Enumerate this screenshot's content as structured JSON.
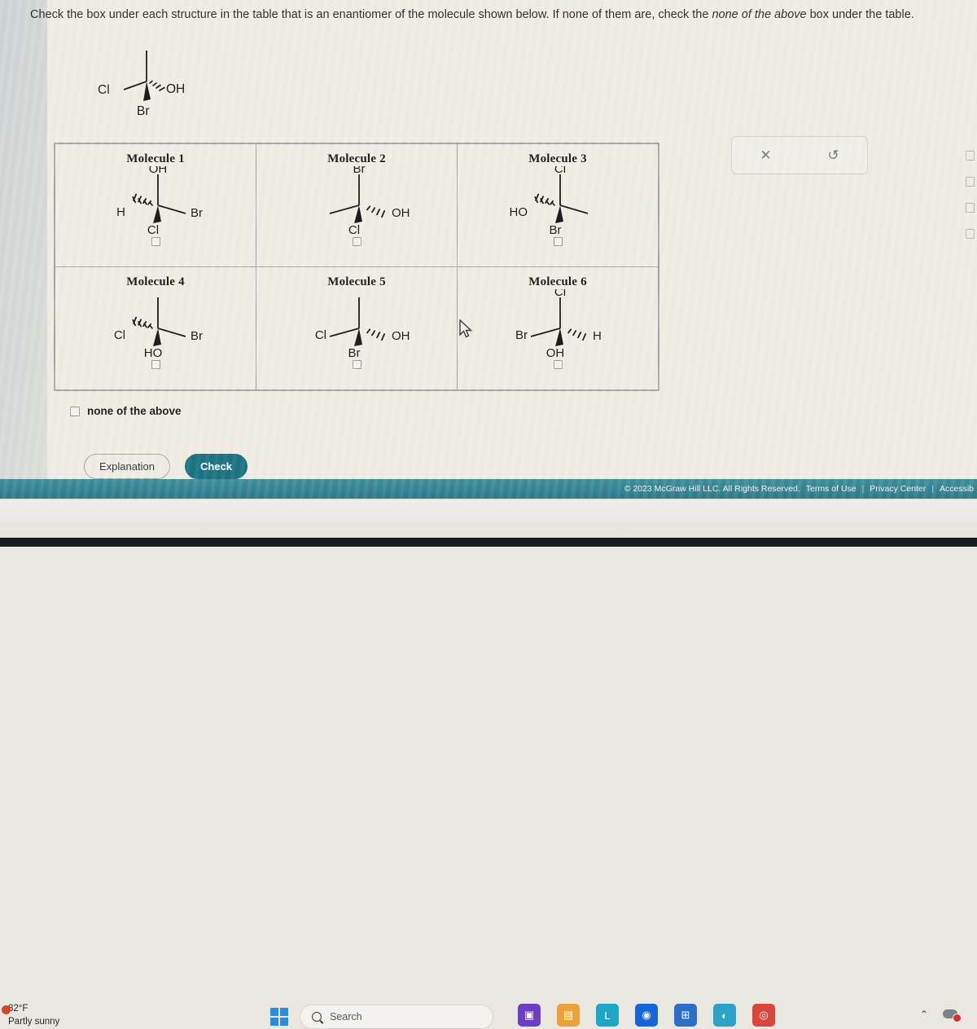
{
  "instruction": {
    "part1": "Check the box under each structure in the table that is an enantiomer of the molecule shown below. If none of them are, check the ",
    "italic": "none of the above",
    "part2": " box under the table."
  },
  "reference_molecule": {
    "name": "reference-stereocenter",
    "substituents": {
      "up": "",
      "left": "Cl",
      "right": "OH",
      "down": "Br"
    },
    "bond_styles": {
      "up": "plain",
      "left": "plain",
      "right": "hashed",
      "down": "wedge"
    }
  },
  "table": {
    "rows": [
      [
        {
          "title": "Molecule 1",
          "up": "OH",
          "left": "H",
          "right": "Br",
          "down": "Cl",
          "bonds": {
            "up": "plain",
            "left": "hashed",
            "right": "plain",
            "down": "wedge"
          },
          "checked": false
        },
        {
          "title": "Molecule 2",
          "up": "Br",
          "left": "",
          "right": "OH",
          "down": "Cl",
          "bonds": {
            "up": "plain",
            "left": "plain",
            "right": "hashed",
            "down": "wedge"
          },
          "checked": false
        },
        {
          "title": "Molecule 3",
          "up": "Cl",
          "left": "HO",
          "right": "",
          "down": "Br",
          "bonds": {
            "up": "plain",
            "left": "hashed",
            "right": "plain",
            "down": "wedge"
          },
          "checked": false
        }
      ],
      [
        {
          "title": "Molecule 4",
          "up": "",
          "left": "Cl",
          "right": "Br",
          "down": "HO",
          "bonds": {
            "up": "plain",
            "left": "hashed",
            "right": "plain",
            "down": "wedge"
          },
          "checked": false
        },
        {
          "title": "Molecule 5",
          "up": "",
          "left": "Cl",
          "right": "OH",
          "down": "Br",
          "bonds": {
            "up": "plain",
            "left": "plain",
            "right": "hashed",
            "down": "wedge"
          },
          "checked": false
        },
        {
          "title": "Molecule 6",
          "up": "Cl",
          "left": "Br",
          "right": "H",
          "down": "OH",
          "bonds": {
            "up": "plain",
            "left": "plain",
            "right": "hashed",
            "down": "wedge"
          },
          "checked": false
        }
      ]
    ]
  },
  "none_of_the_above": {
    "label": "none of the above",
    "checked": false
  },
  "buttons": {
    "explanation": "Explanation",
    "check": "Check"
  },
  "tool_palette": {
    "clear": "✕",
    "reset": "↺"
  },
  "footer": {
    "copyright": "© 2023 McGraw Hill LLC. All Rights Reserved.",
    "terms": "Terms of Use",
    "privacy": "Privacy Center",
    "accessibility": "Accessib"
  },
  "colors": {
    "accent": "#1d6b78",
    "footer": "#2f7280",
    "page": "#edeae0"
  },
  "taskbar": {
    "weather_temp": "82°F",
    "weather_desc": "Partly sunny",
    "search_placeholder": "Search",
    "apps": [
      {
        "name": "meet-icon",
        "glyph": "▣",
        "color": "#6b3fc4"
      },
      {
        "name": "file-explorer-icon",
        "glyph": "▤",
        "color": "#e9a33a"
      },
      {
        "name": "lockdown-browser-icon",
        "glyph": "L",
        "color": "#1da6c8"
      },
      {
        "name": "outlook-icon",
        "glyph": "◉",
        "color": "#1565d8"
      },
      {
        "name": "microsoft-store-icon",
        "glyph": "⊞",
        "color": "#2b6fc9"
      },
      {
        "name": "edge-icon",
        "glyph": "◐",
        "color": "#2aa3c7"
      },
      {
        "name": "chrome-icon",
        "glyph": "◎",
        "color": "#d9463c"
      }
    ]
  }
}
